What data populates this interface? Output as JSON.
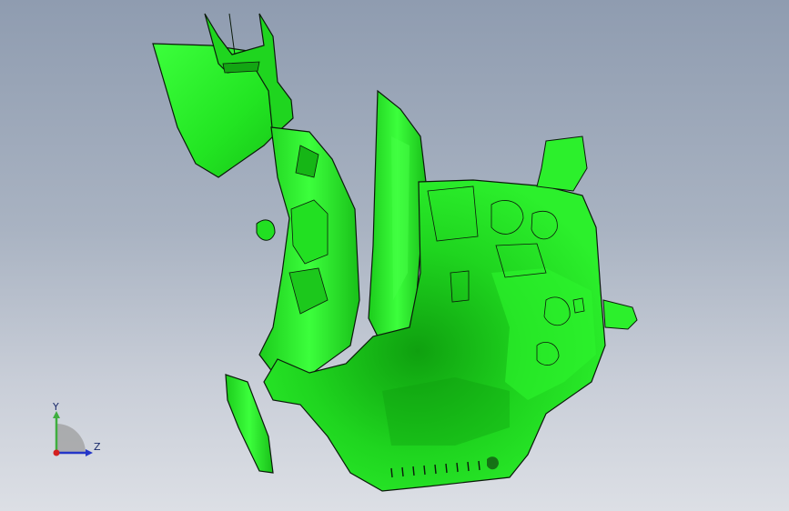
{
  "viewport": {
    "background_top": "#8f9cb0",
    "background_bottom": "#dcdfe5"
  },
  "model": {
    "part_color": "#22ee22",
    "shade_color": "#14b014",
    "highlight_color": "#8dff7a",
    "edge_color": "#0b1a0b"
  },
  "triad": {
    "y_label": "Y",
    "z_label": "Z",
    "y_color": "#3fae3f",
    "z_color": "#2436c8",
    "origin_color": "#d42020"
  }
}
